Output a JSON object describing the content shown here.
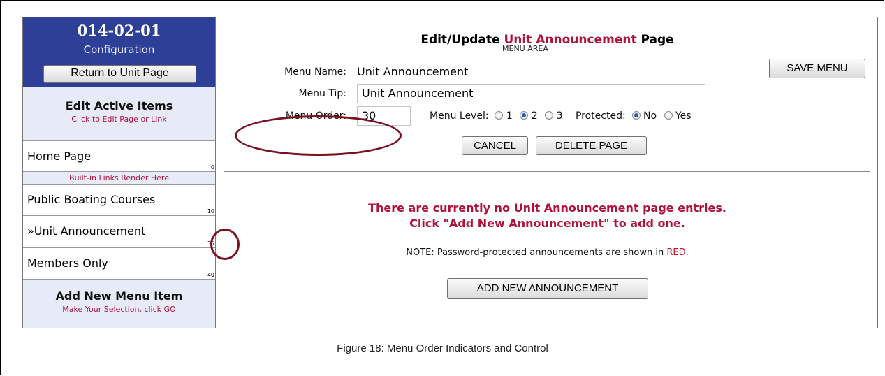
{
  "sidebar": {
    "unit_code": "014-02-01",
    "unit_subtitle": "Configuration",
    "return_button": "Return to Unit Page",
    "edit_active": {
      "heading": "Edit Active Items",
      "hint": "Click to Edit Page or Link"
    },
    "builtin_note": "Built-in Links Render Here",
    "items": [
      {
        "label": "Home Page",
        "order": "0"
      },
      {
        "label": "Public Boating Courses",
        "order": "10"
      },
      {
        "label": "»Unit Announcement",
        "order": "35"
      },
      {
        "label": "Members Only",
        "order": "40"
      }
    ],
    "add_new": {
      "heading": "Add New Menu Item",
      "hint": "Make Your Selection, click GO"
    }
  },
  "main": {
    "title_prefix": "Edit/Update ",
    "title_accent": "Unit Announcement",
    "title_suffix": " Page",
    "menu_area": {
      "legend": "MENU AREA",
      "menu_name_label": "Menu Name:",
      "menu_name_value": "Unit Announcement",
      "menu_tip_label": "Menu Tip:",
      "menu_tip_value": "Unit Announcement",
      "menu_order_label": "Menu Order:",
      "menu_order_value": "30",
      "menu_level_label": "Menu Level:",
      "menu_level_options": [
        "1",
        "2",
        "3"
      ],
      "menu_level_selected": "2",
      "protected_label": "Protected:",
      "protected_options": [
        "No",
        "Yes"
      ],
      "protected_selected": "No",
      "save_button": "SAVE MENU",
      "cancel_button": "CANCEL",
      "delete_button": "DELETE PAGE"
    },
    "message_line1": "There are currently no Unit Announcement page entries.",
    "message_line2": "Click \"Add New Announcement\" to add one.",
    "note_prefix": "NOTE: Password-protected announcements are shown in ",
    "note_red": "RED",
    "note_suffix": ".",
    "add_button": "ADD NEW ANNOUNCEMENT"
  },
  "caption": "Figure 18: Menu Order Indicators and Control",
  "colors": {
    "header_blue": "#2d3f97",
    "accent_red": "#b0123b",
    "annotation": "#7a1020"
  }
}
